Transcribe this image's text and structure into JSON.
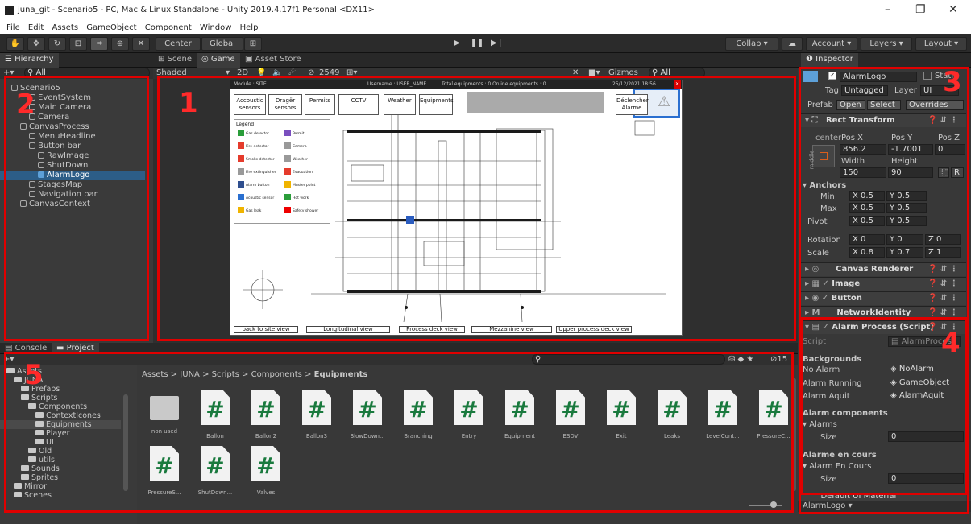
{
  "window": {
    "title": "juna_git - Scenario5 - PC, Mac & Linux Standalone - Unity 2019.4.17f1 Personal <DX11>",
    "minimize": "–",
    "maximize": "❐",
    "close": "✕"
  },
  "menu": [
    "File",
    "Edit",
    "Assets",
    "GameObject",
    "Component",
    "Window",
    "Help"
  ],
  "toolbar": {
    "center": "Center",
    "global": "Global",
    "collab": "Collab ▾",
    "account": "Account",
    "layers": "Layers",
    "layout": "Layout",
    "play": "▶",
    "pause": "❚❚",
    "step": "▶❘"
  },
  "hierarchy": {
    "tab": "Hierarchy",
    "search": "All",
    "add": "+▾",
    "items": [
      {
        "label": "Scenario5",
        "indent": 0,
        "icon": "scene-icon"
      },
      {
        "label": "EventSystem",
        "indent": 2
      },
      {
        "label": "Main Camera",
        "indent": 2
      },
      {
        "label": "Camera",
        "indent": 2
      },
      {
        "label": "CanvasProcess",
        "indent": 1
      },
      {
        "label": "MenuHeadline",
        "indent": 2
      },
      {
        "label": "Button bar",
        "indent": 2
      },
      {
        "label": "RawImage",
        "indent": 3
      },
      {
        "label": "ShutDown",
        "indent": 3
      },
      {
        "label": "AlarmLogo",
        "indent": 3,
        "selected": true
      },
      {
        "label": "StagesMap",
        "indent": 2
      },
      {
        "label": "Navigation bar",
        "indent": 2
      },
      {
        "label": "CanvasContext",
        "indent": 1
      }
    ]
  },
  "scene": {
    "tabs": [
      "Scene",
      "Game",
      "Asset Store"
    ],
    "shading": "Shaded",
    "mode2d": "2D",
    "count": "2549",
    "gizmos": "Gizmos",
    "search": "All"
  },
  "game": {
    "module": "Module : SITE",
    "username": "Username : USER_NAME",
    "equipments": "Total equipments :   0  Online equipments : 0",
    "date": "25/12/2021  18:56",
    "buttons": [
      "Accoustic sensors",
      "Dragër sensors",
      "Permits",
      "CCTV",
      "Weather",
      "Equipments"
    ],
    "alarm_button": "Déclencher Alarme",
    "legend_title": "Legend",
    "legend": [
      "Gas detector",
      "Fire detector",
      "Smoke detector",
      "Fire extinguisher",
      "Alarm button",
      "Acoustic sensor",
      "Gas leak",
      "Permit",
      "Camera",
      "Weather",
      "Evacuation",
      "Muster point",
      "Hot work",
      "Safety shower"
    ],
    "views": [
      "back to site view",
      "Longitudinal view",
      "Process deck view",
      "Mezzanine view",
      "Upper process deck view"
    ]
  },
  "inspector": {
    "tab": "Inspector",
    "name": "AlarmLogo",
    "static": "Static",
    "tag_label": "Tag",
    "tag": "Untagged",
    "layer_label": "Layer",
    "layer": "UI",
    "prefab_label": "Prefab",
    "open": "Open",
    "select": "Select",
    "overrides": "Overrides",
    "rect": {
      "title": "Rect Transform",
      "anchor": "center",
      "side": "middle",
      "posx_l": "Pos X",
      "posy_l": "Pos Y",
      "posz_l": "Pos Z",
      "posx": "856.2",
      "posy": "-1.7001",
      "posz": "0",
      "w_l": "Width",
      "h_l": "Height",
      "w": "150",
      "h": "90",
      "r": "R",
      "anchors": "Anchors",
      "min": "Min",
      "max": "Max",
      "minx": "0.5",
      "miny": "0.5",
      "maxx": "0.5",
      "maxy": "0.5",
      "pivot": "Pivot",
      "pivx": "0.5",
      "pivy": "0.5",
      "rotation": "Rotation",
      "rx": "0",
      "ry": "0",
      "rz": "0",
      "scale": "Scale",
      "sx": "0.8",
      "sy": "0.7",
      "sz": "1"
    },
    "components": [
      "Canvas Renderer",
      "Image",
      "Button",
      "NetworkIdentity"
    ],
    "script": {
      "title": "Alarm Process (Script)",
      "script_l": "Script",
      "script": "AlarmProcess",
      "backgrounds": "Backgrounds",
      "no_alarm_l": "No Alarm",
      "no_alarm": "NoAlarm",
      "running_l": "Alarm Running",
      "running": "GameObject",
      "aquit_l": "Alarm Aquit",
      "aquit": "AlarmAquit",
      "components": "Alarm components",
      "alarms": "Alarms",
      "size_l": "Size",
      "size1": "0",
      "en_cours": "Alarme en cours",
      "alarm_en_cours": "Alarm En Cours",
      "size2": "0"
    },
    "material": "Default UI Material",
    "footer": "AlarmLogo ▾"
  },
  "console_tabs": [
    "Console",
    "Project"
  ],
  "project": {
    "breadcrumb": [
      "Assets",
      "JUNA",
      "Scripts",
      "Components",
      "Equipments"
    ],
    "tree": [
      {
        "label": "Assets",
        "indent": 0
      },
      {
        "label": "JUNA",
        "indent": 1
      },
      {
        "label": "Prefabs",
        "indent": 2
      },
      {
        "label": "Scripts",
        "indent": 2
      },
      {
        "label": "Components",
        "indent": 3
      },
      {
        "label": "ContextIcones",
        "indent": 4
      },
      {
        "label": "Equipments",
        "indent": 4,
        "selected": true
      },
      {
        "label": "Player",
        "indent": 4
      },
      {
        "label": "UI",
        "indent": 4
      },
      {
        "label": "Old",
        "indent": 3
      },
      {
        "label": "utils",
        "indent": 3
      },
      {
        "label": "Sounds",
        "indent": 2
      },
      {
        "label": "Sprites",
        "indent": 2
      },
      {
        "label": "Mirror",
        "indent": 1
      },
      {
        "label": "Scenes",
        "indent": 1
      }
    ],
    "assets": [
      "non used",
      "Ballon",
      "Ballon2",
      "Ballon3",
      "BlowDown...",
      "Branching",
      "Entry",
      "Equipment",
      "ESDV",
      "Exit",
      "Leaks",
      "LevelCont...",
      "PressureC...",
      "PressureS...",
      "ShutDown...",
      "Valves"
    ],
    "hidden_count": "15"
  },
  "annotations": [
    "1",
    "2",
    "3",
    "4",
    "5"
  ],
  "colors": {
    "accent": "#e00000",
    "selection": "#2c5d87",
    "script_green": "#1a7a3e"
  }
}
